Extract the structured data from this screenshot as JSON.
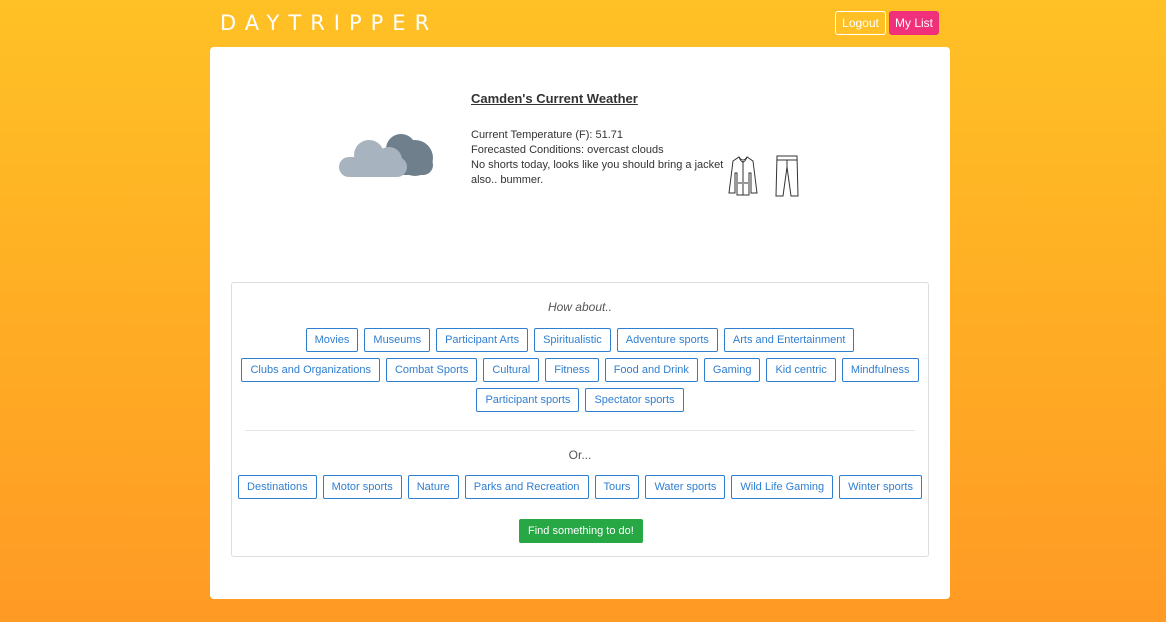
{
  "header": {
    "brand": "DAYTRIPPER",
    "logout_label": "Logout",
    "mylist_label": "My List"
  },
  "weather": {
    "title": "Camden's Current Weather",
    "temperature_text": "Current Temperature (F): 51.71",
    "conditions_text": "Forecasted Conditions: overcast clouds",
    "advice_text": "No shorts today, looks like you should bring a jacket also.. bummer.",
    "icons": [
      "cloud-icon",
      "jacket-icon",
      "pants-icon"
    ]
  },
  "activities": {
    "prompt": "How about..",
    "row1": [
      "Movies",
      "Museums",
      "Participant Arts",
      "Spiritualistic",
      "Adventure sports",
      "Arts and Entertainment"
    ],
    "row2": [
      "Clubs and Organizations",
      "Combat Sports",
      "Cultural",
      "Fitness",
      "Food and Drink",
      "Gaming",
      "Kid centric",
      "Mindfulness"
    ],
    "row3": [
      "Participant sports",
      "Spectator sports"
    ],
    "or_label": "Or...",
    "row4": [
      "Destinations",
      "Motor sports",
      "Nature",
      "Parks and Recreation",
      "Tours",
      "Water sports",
      "Wild Life Gaming",
      "Winter sports"
    ],
    "find_label": "Find something to do!"
  },
  "colors": {
    "bg_top": "#ffc125",
    "bg_bottom": "#ff9a24",
    "accent_pink": "#f0307a",
    "tag_blue": "#2f7fd1",
    "find_green": "#28a745"
  }
}
